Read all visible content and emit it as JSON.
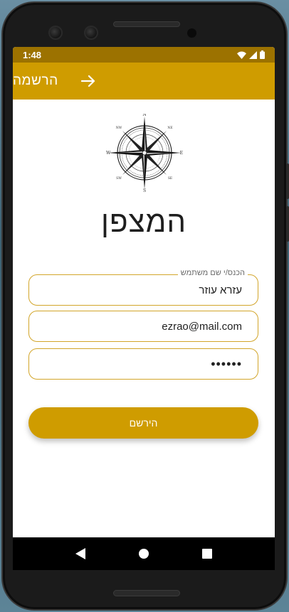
{
  "status_bar": {
    "time": "1:48"
  },
  "app_bar": {
    "title": "הרשמה",
    "back_icon": "arrow-right-icon"
  },
  "app_name": "המצפן",
  "form": {
    "username": {
      "label": "הכנס/י שם משתמש",
      "value": "עזרא עוזר"
    },
    "email": {
      "value": "ezrao@mail.com"
    },
    "password": {
      "value": "••••••"
    },
    "register_label": "הירשם"
  },
  "colors": {
    "accent": "#cf9c00",
    "status_bar": "#9c7200",
    "field_border": "#d2a52a"
  },
  "nav_bar": {
    "back": "triangle-back-icon",
    "home": "circle-home-icon",
    "recents": "square-recents-icon"
  }
}
